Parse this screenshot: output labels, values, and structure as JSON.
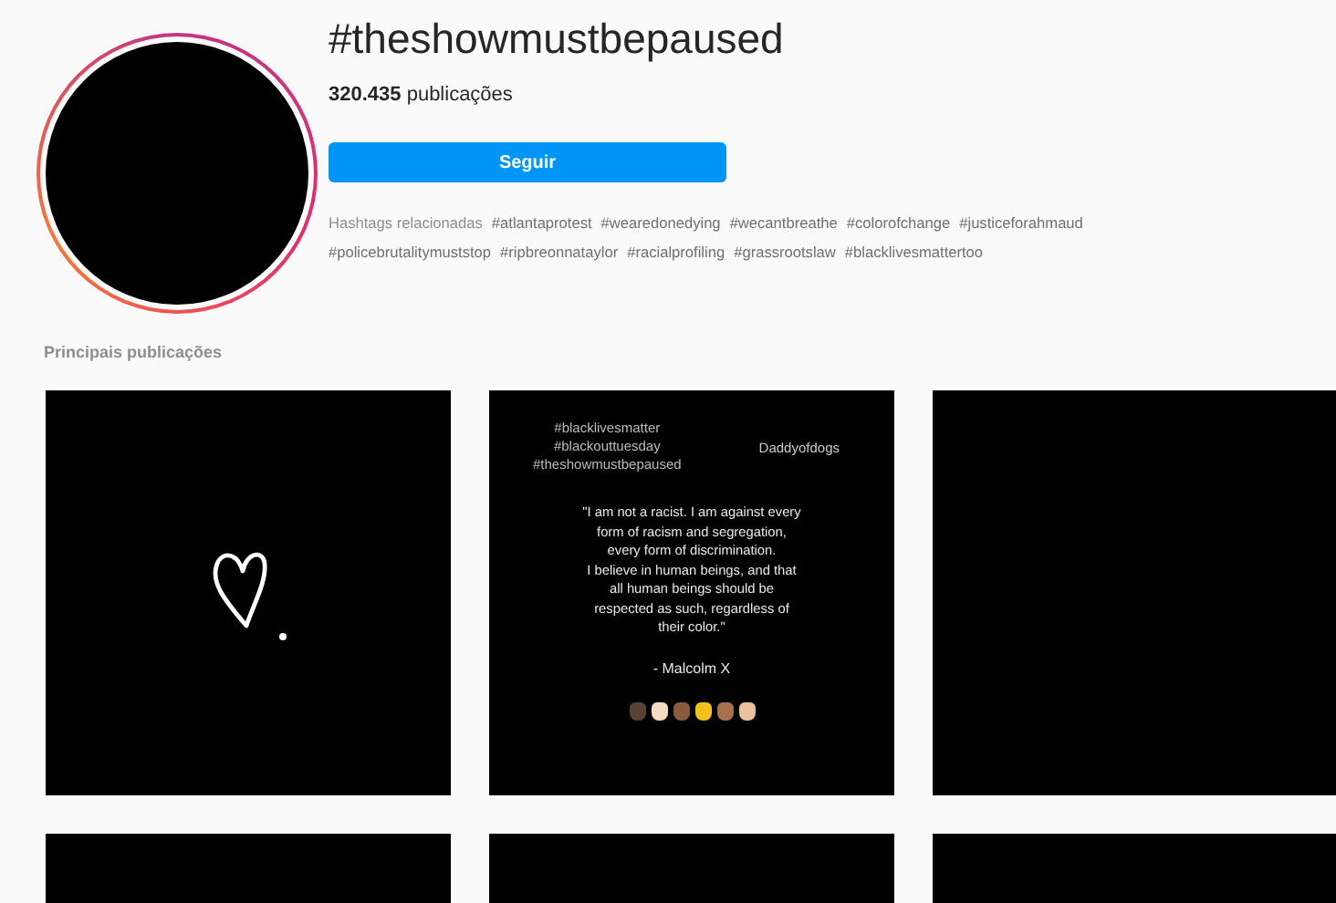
{
  "header": {
    "title": "#theshowmustbepaused",
    "post_count": "320.435",
    "post_count_label": "publicações",
    "follow_button": "Seguir",
    "related_label": "Hashtags relacionadas",
    "related_hashtags": [
      "#atlantaprotest",
      "#wearedonedying",
      "#wecantbreathe",
      "#colorofchange",
      "#justiceforahmaud",
      "#policebrutalitymuststop",
      "#ripbreonnataylor",
      "#racialprofiling",
      "#grassrootslaw",
      "#blacklivesmattertoo"
    ]
  },
  "section_title": "Principais publicações",
  "posts": [
    {
      "kind": "heart"
    },
    {
      "kind": "quote",
      "hashtags": "#blacklivesmatter\n#blackouttuesday\n#theshowmustbepaused",
      "author": "Daddyofdogs",
      "quote": "\"I am not a racist. I am against every\nform of racism and segregation,\nevery form of discrimination.\nI believe in human beings, and that\nall human beings should be\nrespected as such, regardless of\ntheir color.\"",
      "attribution": "- Malcolm X",
      "fists": [
        {
          "color": "#5a4136"
        },
        {
          "color": "#f3dcc0"
        },
        {
          "color": "#8a5a3c"
        },
        {
          "color": "#f2c21c"
        },
        {
          "color": "#a8704c"
        },
        {
          "color": "#e8c29c"
        }
      ]
    },
    {
      "kind": "blank"
    },
    {
      "kind": "blank"
    },
    {
      "kind": "blank"
    },
    {
      "kind": "blank"
    }
  ]
}
